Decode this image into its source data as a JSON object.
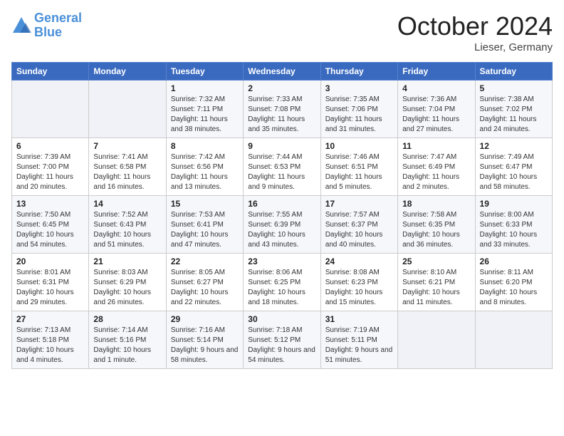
{
  "header": {
    "logo_line1": "General",
    "logo_line2": "Blue",
    "month": "October 2024",
    "location": "Lieser, Germany"
  },
  "weekdays": [
    "Sunday",
    "Monday",
    "Tuesday",
    "Wednesday",
    "Thursday",
    "Friday",
    "Saturday"
  ],
  "weeks": [
    [
      {
        "day": "",
        "info": ""
      },
      {
        "day": "",
        "info": ""
      },
      {
        "day": "1",
        "info": "Sunrise: 7:32 AM\nSunset: 7:11 PM\nDaylight: 11 hours and 38 minutes."
      },
      {
        "day": "2",
        "info": "Sunrise: 7:33 AM\nSunset: 7:08 PM\nDaylight: 11 hours and 35 minutes."
      },
      {
        "day": "3",
        "info": "Sunrise: 7:35 AM\nSunset: 7:06 PM\nDaylight: 11 hours and 31 minutes."
      },
      {
        "day": "4",
        "info": "Sunrise: 7:36 AM\nSunset: 7:04 PM\nDaylight: 11 hours and 27 minutes."
      },
      {
        "day": "5",
        "info": "Sunrise: 7:38 AM\nSunset: 7:02 PM\nDaylight: 11 hours and 24 minutes."
      }
    ],
    [
      {
        "day": "6",
        "info": "Sunrise: 7:39 AM\nSunset: 7:00 PM\nDaylight: 11 hours and 20 minutes."
      },
      {
        "day": "7",
        "info": "Sunrise: 7:41 AM\nSunset: 6:58 PM\nDaylight: 11 hours and 16 minutes."
      },
      {
        "day": "8",
        "info": "Sunrise: 7:42 AM\nSunset: 6:56 PM\nDaylight: 11 hours and 13 minutes."
      },
      {
        "day": "9",
        "info": "Sunrise: 7:44 AM\nSunset: 6:53 PM\nDaylight: 11 hours and 9 minutes."
      },
      {
        "day": "10",
        "info": "Sunrise: 7:46 AM\nSunset: 6:51 PM\nDaylight: 11 hours and 5 minutes."
      },
      {
        "day": "11",
        "info": "Sunrise: 7:47 AM\nSunset: 6:49 PM\nDaylight: 11 hours and 2 minutes."
      },
      {
        "day": "12",
        "info": "Sunrise: 7:49 AM\nSunset: 6:47 PM\nDaylight: 10 hours and 58 minutes."
      }
    ],
    [
      {
        "day": "13",
        "info": "Sunrise: 7:50 AM\nSunset: 6:45 PM\nDaylight: 10 hours and 54 minutes."
      },
      {
        "day": "14",
        "info": "Sunrise: 7:52 AM\nSunset: 6:43 PM\nDaylight: 10 hours and 51 minutes."
      },
      {
        "day": "15",
        "info": "Sunrise: 7:53 AM\nSunset: 6:41 PM\nDaylight: 10 hours and 47 minutes."
      },
      {
        "day": "16",
        "info": "Sunrise: 7:55 AM\nSunset: 6:39 PM\nDaylight: 10 hours and 43 minutes."
      },
      {
        "day": "17",
        "info": "Sunrise: 7:57 AM\nSunset: 6:37 PM\nDaylight: 10 hours and 40 minutes."
      },
      {
        "day": "18",
        "info": "Sunrise: 7:58 AM\nSunset: 6:35 PM\nDaylight: 10 hours and 36 minutes."
      },
      {
        "day": "19",
        "info": "Sunrise: 8:00 AM\nSunset: 6:33 PM\nDaylight: 10 hours and 33 minutes."
      }
    ],
    [
      {
        "day": "20",
        "info": "Sunrise: 8:01 AM\nSunset: 6:31 PM\nDaylight: 10 hours and 29 minutes."
      },
      {
        "day": "21",
        "info": "Sunrise: 8:03 AM\nSunset: 6:29 PM\nDaylight: 10 hours and 26 minutes."
      },
      {
        "day": "22",
        "info": "Sunrise: 8:05 AM\nSunset: 6:27 PM\nDaylight: 10 hours and 22 minutes."
      },
      {
        "day": "23",
        "info": "Sunrise: 8:06 AM\nSunset: 6:25 PM\nDaylight: 10 hours and 18 minutes."
      },
      {
        "day": "24",
        "info": "Sunrise: 8:08 AM\nSunset: 6:23 PM\nDaylight: 10 hours and 15 minutes."
      },
      {
        "day": "25",
        "info": "Sunrise: 8:10 AM\nSunset: 6:21 PM\nDaylight: 10 hours and 11 minutes."
      },
      {
        "day": "26",
        "info": "Sunrise: 8:11 AM\nSunset: 6:20 PM\nDaylight: 10 hours and 8 minutes."
      }
    ],
    [
      {
        "day": "27",
        "info": "Sunrise: 7:13 AM\nSunset: 5:18 PM\nDaylight: 10 hours and 4 minutes."
      },
      {
        "day": "28",
        "info": "Sunrise: 7:14 AM\nSunset: 5:16 PM\nDaylight: 10 hours and 1 minute."
      },
      {
        "day": "29",
        "info": "Sunrise: 7:16 AM\nSunset: 5:14 PM\nDaylight: 9 hours and 58 minutes."
      },
      {
        "day": "30",
        "info": "Sunrise: 7:18 AM\nSunset: 5:12 PM\nDaylight: 9 hours and 54 minutes."
      },
      {
        "day": "31",
        "info": "Sunrise: 7:19 AM\nSunset: 5:11 PM\nDaylight: 9 hours and 51 minutes."
      },
      {
        "day": "",
        "info": ""
      },
      {
        "day": "",
        "info": ""
      }
    ]
  ]
}
